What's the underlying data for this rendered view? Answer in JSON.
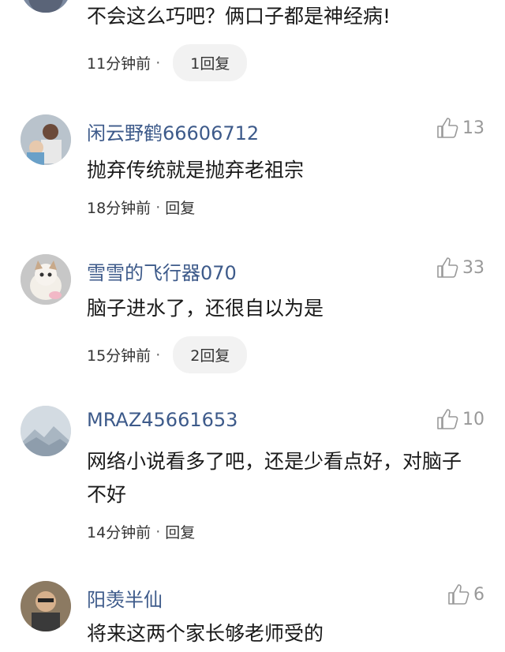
{
  "comments": [
    {
      "username": "",
      "text": "不会这么巧吧？俩口子都是神经病!",
      "time": "11分钟前",
      "reply": "1回复",
      "likes": ""
    },
    {
      "username": "闲云野鹤66606712",
      "text": "抛弃传统就是抛弃老祖宗",
      "time": "18分钟前",
      "reply": "回复",
      "likes": "13"
    },
    {
      "username": "雪雪的飞行器070",
      "text": "脑子进水了，还很自以为是",
      "time": "15分钟前",
      "reply": "2回复",
      "likes": "33"
    },
    {
      "username": "MRAZ45661653",
      "text": "网络小说看多了吧，还是少看点好，对脑子不好",
      "time": "14分钟前",
      "reply": "回复",
      "likes": "10"
    },
    {
      "username": "阳羡半仙",
      "text": "将来这两个家长够老师受的",
      "time": "",
      "reply": "",
      "likes": "6"
    }
  ],
  "separator": "·",
  "colors": {
    "username": "#3d5a8a",
    "text": "#1a1a1a",
    "meta": "#333333",
    "like": "#999999",
    "pill_bg": "#f2f2f2"
  }
}
